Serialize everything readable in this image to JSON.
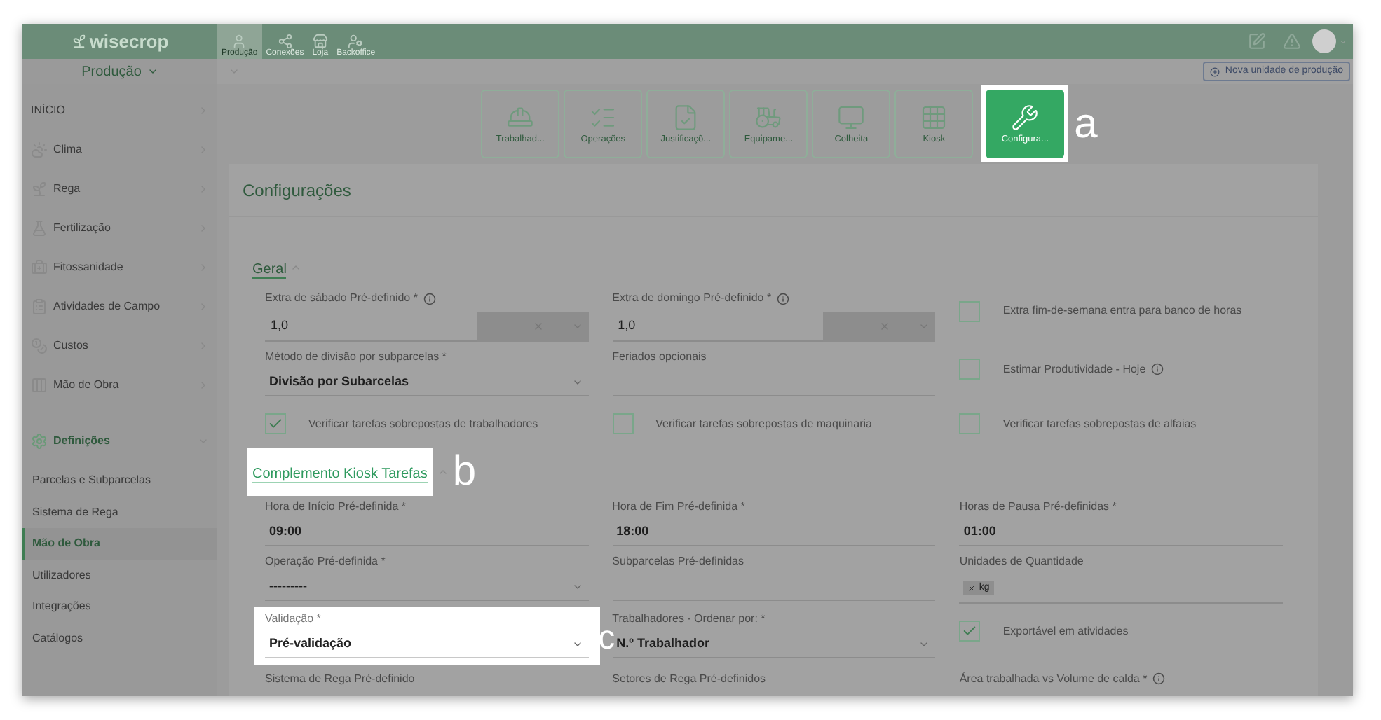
{
  "app": {
    "logo": "wisecrop",
    "production_selector": "Produção",
    "new_unit_button": "Nova unidade de produção"
  },
  "nav_tabs": [
    {
      "label": "Produção",
      "selected": true
    },
    {
      "label": "Conexões",
      "selected": false
    },
    {
      "label": "Loja",
      "selected": false
    },
    {
      "label": "Backoffice",
      "selected": false
    }
  ],
  "sidebar": {
    "items": [
      {
        "label": "INÍCIO",
        "expanded": false
      },
      {
        "label": "Clima",
        "expanded": false
      },
      {
        "label": "Rega",
        "expanded": false
      },
      {
        "label": "Fertilização",
        "expanded": false
      },
      {
        "label": "Fitossanidade",
        "expanded": false
      },
      {
        "label": "Atividades de Campo",
        "expanded": false
      },
      {
        "label": "Custos",
        "expanded": false
      },
      {
        "label": "Mão de Obra",
        "expanded": false
      },
      {
        "label": "Definições",
        "expanded": true,
        "children": [
          {
            "label": "Parcelas e Subparcelas",
            "selected": false
          },
          {
            "label": "Sistema de Rega",
            "selected": false
          },
          {
            "label": "Mão de Obra",
            "selected": true
          },
          {
            "label": "Utilizadores",
            "selected": false
          },
          {
            "label": "Integrações",
            "selected": false
          },
          {
            "label": "Catálogos",
            "selected": false
          }
        ]
      }
    ]
  },
  "toolbar": [
    {
      "label": "Trabalhad...",
      "selected": false,
      "highlighted": false
    },
    {
      "label": "Operações",
      "selected": false,
      "highlighted": false
    },
    {
      "label": "Justificaçõ...",
      "selected": false,
      "highlighted": false
    },
    {
      "label": "Equipame...",
      "selected": false,
      "highlighted": false
    },
    {
      "label": "Colheita",
      "selected": false,
      "highlighted": false
    },
    {
      "label": "Kiosk",
      "selected": false,
      "highlighted": false
    },
    {
      "label": "Configura...",
      "selected": true,
      "highlighted": true,
      "callout": "a"
    }
  ],
  "card": {
    "title": "Configurações",
    "sections": [
      {
        "title": "Geral",
        "expanded": true,
        "highlighted": false,
        "fields": [
          {
            "kind": "number_unit",
            "label": "Extra de sábado Pré-definido *",
            "info": true,
            "value": "1,0",
            "highlighted": false
          },
          {
            "kind": "number_unit",
            "label": "Extra de domingo Pré-definido *",
            "info": true,
            "value": "1,0",
            "highlighted": false
          },
          {
            "kind": "checkbox",
            "label": "Extra fim-de-semana entra para banco de horas",
            "checked": false,
            "info": false,
            "highlighted": false
          },
          {
            "kind": "select",
            "label": "Método de divisão por subparcelas *",
            "value": "Divisão por Subarcelas",
            "info": false,
            "highlighted": false
          },
          {
            "kind": "text",
            "label": "Feriados opcionais",
            "info": false,
            "highlighted": false
          },
          {
            "kind": "checkbox",
            "label": "Estimar Produtividade - Hoje",
            "checked": false,
            "info": true,
            "highlighted": false
          },
          {
            "kind": "checkbox",
            "label": "Verificar tarefas sobrepostas de trabalhadores",
            "checked": true,
            "info": false,
            "highlighted": false
          },
          {
            "kind": "checkbox",
            "label": "Verificar tarefas sobrepostas de maquinaria",
            "checked": false,
            "info": false,
            "highlighted": false
          },
          {
            "kind": "checkbox",
            "label": "Verificar tarefas sobrepostas de alfaias",
            "checked": false,
            "info": false,
            "highlighted": false
          }
        ]
      },
      {
        "title": "Complemento Kiosk Tarefas",
        "expanded": true,
        "highlighted": true,
        "callout": "b",
        "fields": [
          {
            "kind": "text",
            "label": "Hora de Início Pré-definida *",
            "value": "09:00",
            "info": false,
            "highlighted": false
          },
          {
            "kind": "text",
            "label": "Hora de Fim Pré-definida *",
            "value": "18:00",
            "info": false,
            "highlighted": false
          },
          {
            "kind": "text",
            "label": "Horas de Pausa Pré-definidas *",
            "value": "01:00",
            "info": false,
            "highlighted": false
          },
          {
            "kind": "select",
            "label": "Operação Pré-definida *",
            "value": "---------",
            "info": false,
            "highlighted": false
          },
          {
            "kind": "text",
            "label": "Subparcelas Pré-definidas",
            "info": false,
            "highlighted": false
          },
          {
            "kind": "tags",
            "label": "Unidades de Quantidade",
            "tags": [
              "kg"
            ],
            "info": false,
            "highlighted": false
          },
          {
            "kind": "select",
            "label": "Validação *",
            "value": "Pré-validação",
            "info": false,
            "highlighted": true,
            "callout": "c"
          },
          {
            "kind": "select",
            "label": "Trabalhadores - Ordenar por: *",
            "value": "N.º Trabalhador",
            "info": false,
            "highlighted": false
          },
          {
            "kind": "checkbox",
            "label": "Exportável em atividades",
            "checked": true,
            "info": false,
            "highlighted": false
          },
          {
            "kind": "label_only",
            "label": "Sistema de Rega Pré-definido",
            "info": false,
            "highlighted": false
          },
          {
            "kind": "label_only",
            "label": "Setores de Rega Pré-definidos",
            "info": false,
            "highlighted": false
          },
          {
            "kind": "label_only",
            "label": "Área trabalhada vs Volume de calda *",
            "info": true,
            "highlighted": false
          }
        ]
      }
    ]
  }
}
